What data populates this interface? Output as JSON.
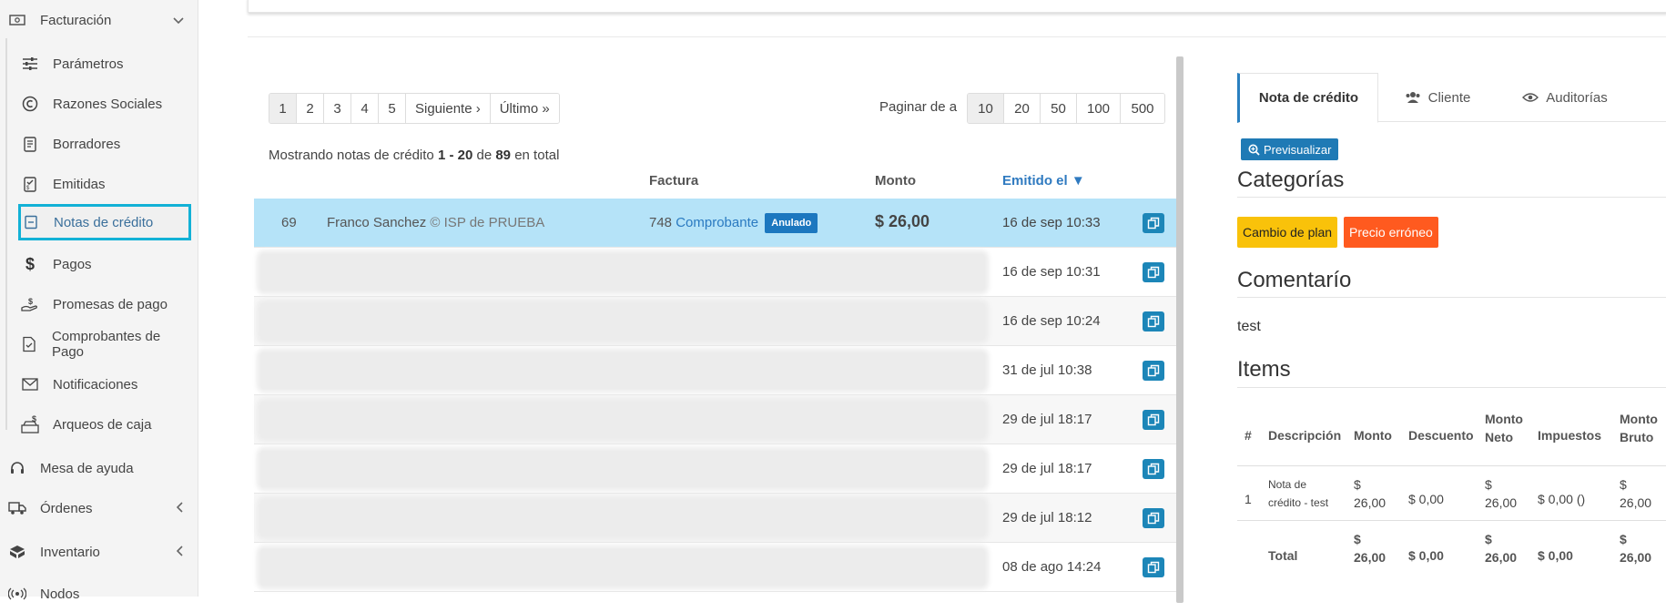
{
  "sidebar": {
    "facturacion": "Facturación",
    "items": [
      {
        "label": "Parámetros",
        "icon": "sliders-icon"
      },
      {
        "label": "Razones Sociales",
        "icon": "copyright-icon"
      },
      {
        "label": "Borradores",
        "icon": "draft-icon"
      },
      {
        "label": "Emitidas",
        "icon": "issued-icon"
      },
      {
        "label": "Notas de crédito",
        "icon": "credit-note-icon"
      },
      {
        "label": "Pagos",
        "icon": "dollar-icon"
      },
      {
        "label": "Promesas de pago",
        "icon": "hand-money-icon"
      },
      {
        "label": "Comprobantes de Pago",
        "icon": "receipt-icon"
      },
      {
        "label": "Notificaciones",
        "icon": "envelope-icon"
      },
      {
        "label": "Arqueos de caja",
        "icon": "cash-register-icon"
      }
    ],
    "mesa_ayuda": "Mesa de ayuda",
    "ordenes": "Órdenes",
    "inventario": "Inventario",
    "nodos": "Nodos"
  },
  "pagination": {
    "pages": [
      "1",
      "2",
      "3",
      "4",
      "5",
      "Siguiente ›",
      "Último »"
    ],
    "per_page_label": "Paginar de a",
    "per_page_options": [
      "10",
      "20",
      "50",
      "100",
      "500"
    ]
  },
  "summary": {
    "prefix": "Mostrando notas de crédito",
    "range": "1 - 20",
    "of": "de",
    "total": "89",
    "suffix": "en total"
  },
  "table": {
    "headers": {
      "factura": "Factura",
      "monto": "Monto",
      "emitido": "Emitido el ▼"
    },
    "first_row": {
      "id": "69",
      "client": "Franco Sanchez",
      "separator": "©",
      "company": "ISP de PRUEBA",
      "invoice_number": "748",
      "invoice_link": "Comprobante",
      "badge": "Anulado",
      "amount": "$ 26,00",
      "date": "16 de sep 10:33"
    },
    "dates": [
      "16 de sep 10:31",
      "16 de sep 10:24",
      "31 de jul 10:38",
      "29 de jul 18:17",
      "29 de jul 18:17",
      "29 de jul 18:12",
      "08 de ago 14:24"
    ]
  },
  "detail": {
    "tabs": [
      "Nota de crédito",
      "Cliente",
      "Auditorías"
    ],
    "preview_button": "Previsualizar",
    "categories_title": "Categorías",
    "tags": [
      {
        "label": "Cambio de plan",
        "color": "#f9c20a"
      },
      {
        "label": "Precio erróneo",
        "color": "#ff5a1f"
      }
    ],
    "comment_title": "Comentarío",
    "comment": "test",
    "items_title": "Items",
    "items_headers": [
      "#",
      "Descripción",
      "Monto",
      "Descuento",
      "Monto Neto",
      "Impuestos",
      "Monto Bruto"
    ],
    "item": {
      "num": "1",
      "description": "Nota de crédito - test",
      "monto": "$ 26,00",
      "descuento": "$ 0,00",
      "neto": "$ 26,00",
      "impuestos": "$ 0,00 ()",
      "bruto": "$ 26,00"
    },
    "total": {
      "label": "Total",
      "monto": "$ 26,00",
      "descuento": "$ 0,00",
      "neto": "$ 26,00",
      "impuestos": "$ 0,00",
      "bruto": "$ 26,00"
    }
  }
}
